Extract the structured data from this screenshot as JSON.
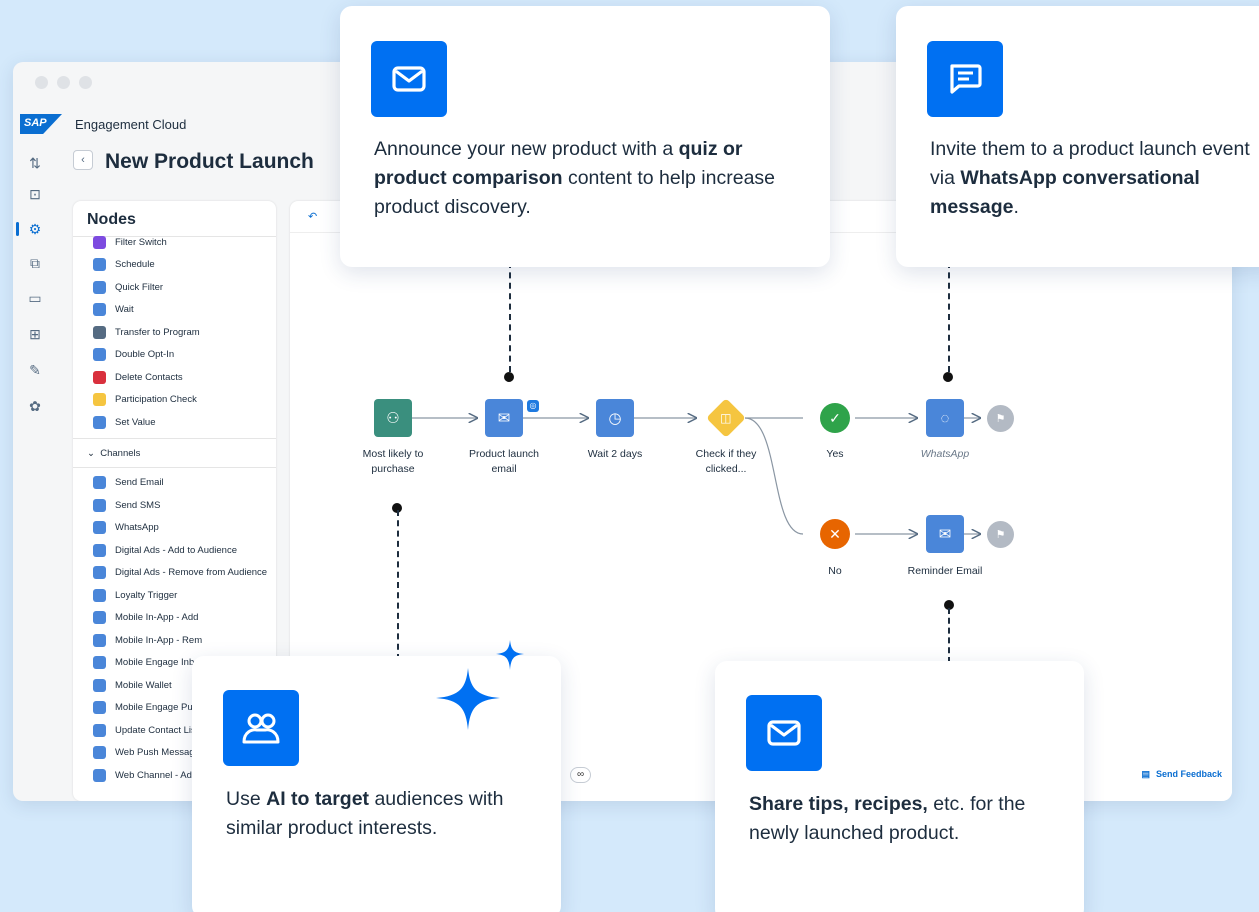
{
  "brand": {
    "name": "Engagement Cloud",
    "logo": "SAP"
  },
  "page": {
    "title": "New Product Launch",
    "back": "‹"
  },
  "colors": {
    "accent": "#0070f2",
    "canvas_blue": "#4a86d9",
    "green": "#2fa34a",
    "orange": "#e76500",
    "yellow": "#f5c540"
  },
  "nodes_panel": {
    "title": "Nodes",
    "items": [
      {
        "label": "Filter Switch",
        "color": "#7d4be0",
        "icon": "filter-switch-icon"
      },
      {
        "label": "Schedule",
        "color": "#4a86d9",
        "icon": "calendar-icon"
      },
      {
        "label": "Quick Filter",
        "color": "#4a86d9",
        "icon": "quick-filter-icon"
      },
      {
        "label": "Wait",
        "color": "#4a86d9",
        "icon": "clock-icon"
      },
      {
        "label": "Transfer to Program",
        "color": "#556b82",
        "icon": "transfer-icon"
      },
      {
        "label": "Double Opt-In",
        "color": "#4a86d9",
        "icon": "opt-in-icon"
      },
      {
        "label": "Delete Contacts",
        "color": "#d9303d",
        "icon": "delete-icon"
      },
      {
        "label": "Participation Check",
        "color": "#f5c540",
        "icon": "check-icon"
      },
      {
        "label": "Set Value",
        "color": "#4a86d9",
        "icon": "set-value-icon"
      }
    ],
    "channels_label": "Channels",
    "channels": [
      {
        "label": "Send Email",
        "color": "#4a86d9",
        "icon": "email-icon"
      },
      {
        "label": "Send SMS",
        "color": "#4a86d9",
        "icon": "sms-icon"
      },
      {
        "label": "WhatsApp",
        "color": "#4a86d9",
        "icon": "whatsapp-icon"
      },
      {
        "label": "Digital Ads - Add to Audience",
        "color": "#4a86d9",
        "icon": "ads-icon"
      },
      {
        "label": "Digital Ads - Remove from Audience",
        "color": "#4a86d9",
        "icon": "ads-icon"
      },
      {
        "label": "Loyalty Trigger",
        "color": "#4a86d9",
        "icon": "loyalty-icon"
      },
      {
        "label": "Mobile In-App - Add",
        "color": "#4a86d9",
        "icon": "mobile-icon"
      },
      {
        "label": "Mobile In-App - Rem",
        "color": "#4a86d9",
        "icon": "mobile-icon"
      },
      {
        "label": "Mobile Engage Inbo",
        "color": "#4a86d9",
        "icon": "inbox-icon"
      },
      {
        "label": "Mobile Wallet",
        "color": "#4a86d9",
        "icon": "wallet-icon"
      },
      {
        "label": "Mobile Engage Pus",
        "color": "#4a86d9",
        "icon": "push-icon"
      },
      {
        "label": "Update Contact Lis",
        "color": "#4a86d9",
        "icon": "contact-list-icon"
      },
      {
        "label": "Web Push Message",
        "color": "#4a86d9",
        "icon": "web-push-icon"
      },
      {
        "label": "Web Channel - Add",
        "color": "#4a86d9",
        "icon": "web-channel-icon"
      }
    ]
  },
  "flow": {
    "nodes": [
      {
        "id": "most-likely",
        "label": "Most likely to purchase"
      },
      {
        "id": "launch-email",
        "label": "Product launch email"
      },
      {
        "id": "wait",
        "label": "Wait 2 days"
      },
      {
        "id": "check",
        "label": "Check if they clicked..."
      },
      {
        "id": "yes",
        "label": "Yes"
      },
      {
        "id": "whatsapp",
        "label": "WhatsApp"
      },
      {
        "id": "no",
        "label": "No"
      },
      {
        "id": "reminder",
        "label": "Reminder Email"
      }
    ]
  },
  "toolbar": {
    "undo": "↶",
    "zoom": "∞",
    "feedback": "Send Feedback"
  },
  "cards": {
    "quiz": {
      "pre": "Announce your new product with a ",
      "bold": "quiz or product comparison",
      "post": " content to help increase product discovery."
    },
    "whatsapp": {
      "pre": "Invite them to a product launch event via ",
      "bold": "WhatsApp conversational message",
      "post": "."
    },
    "ai": {
      "pre": "Use ",
      "bold": "AI to target",
      "post": " audiences with similar product interests."
    },
    "tips": {
      "pre": "",
      "bold": "Share tips, recipes,",
      "post": " etc. for the newly launched product."
    }
  }
}
